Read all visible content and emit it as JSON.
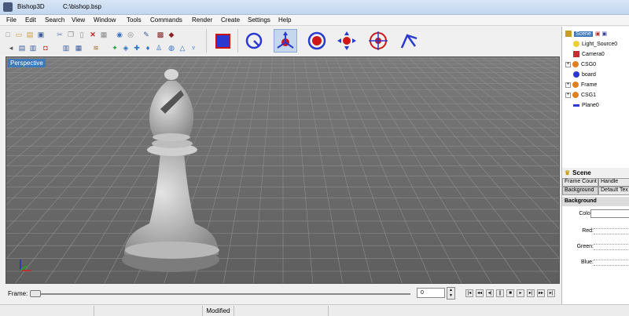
{
  "window": {
    "app_name": "Bishop3D",
    "file_path": "C:\\bishop.bsp"
  },
  "menu": [
    "File",
    "Edit",
    "Search",
    "View",
    "Window",
    "Tools",
    "Commands",
    "Render",
    "Create",
    "Settings",
    "Help"
  ],
  "viewport": {
    "label": "Perspective"
  },
  "scene_tree": {
    "root": "Scene",
    "items": [
      "Light_Source0",
      "Camera0",
      "CSG0",
      "board",
      "Frame",
      "CSG1",
      "Plane0"
    ]
  },
  "properties": {
    "title": "Scene",
    "tabs_row1": [
      "Frame Count",
      "Handle"
    ],
    "tabs_row2": [
      "Background",
      "Default Tex"
    ],
    "section": "Background",
    "color_label": "Color:",
    "red_label": "Red:",
    "green_label": "Green:",
    "blue_label": "Blue:"
  },
  "timeline": {
    "frame_label": "Frame:",
    "frame_value": "0"
  },
  "status": {
    "modified": "Modified"
  },
  "colors": {
    "accent": "#3e78b8",
    "viewport_bg": "#6b6b6b",
    "grid": "#8a8a8a",
    "chess_piece": "#c8c8c8"
  },
  "icons": [
    "new-icon",
    "open-icon",
    "save-icon",
    "cut-icon",
    "copy-icon",
    "paste-icon",
    "delete-icon",
    "undo-icon",
    "redo-icon",
    "render-icon",
    "select-icon",
    "scale-icon",
    "move-icon",
    "rotate-icon"
  ]
}
